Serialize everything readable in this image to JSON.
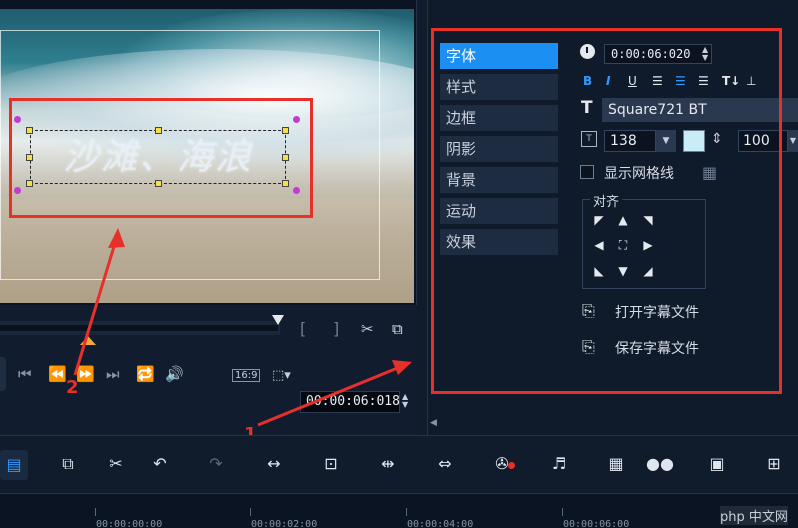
{
  "preview": {
    "title_text": "沙滩、海浪"
  },
  "transport": {
    "mark_in": "[",
    "mark_out": "]",
    "aspect_ratio": "16:9",
    "timecode": "00:00:06:018"
  },
  "panel": {
    "tabs": [
      {
        "label": "字体",
        "active": true
      },
      {
        "label": "样式",
        "active": false
      },
      {
        "label": "边框",
        "active": false
      },
      {
        "label": "阴影",
        "active": false
      },
      {
        "label": "背景",
        "active": false
      },
      {
        "label": "运动",
        "active": false
      },
      {
        "label": "效果",
        "active": false
      }
    ],
    "duration": "0:00:06:020",
    "format_buttons": [
      "B",
      "I",
      "U"
    ],
    "font_name": "Square721 BT",
    "font_size": "138",
    "font_color": "#c9ecf9",
    "line_spacing": "100",
    "show_grid_label": "显示网格线",
    "align_title": "对齐",
    "open_subtitle": "打开字幕文件",
    "save_subtitle": "保存字幕文件"
  },
  "annotations": {
    "label_1": "1",
    "label_2": "2",
    "color": "#e8302a"
  },
  "ruler": {
    "ticks": [
      "00:00:00:00",
      "00:00:02:00",
      "00:00:04:00",
      "00:00:06:00"
    ]
  },
  "watermark": "php 中文网"
}
